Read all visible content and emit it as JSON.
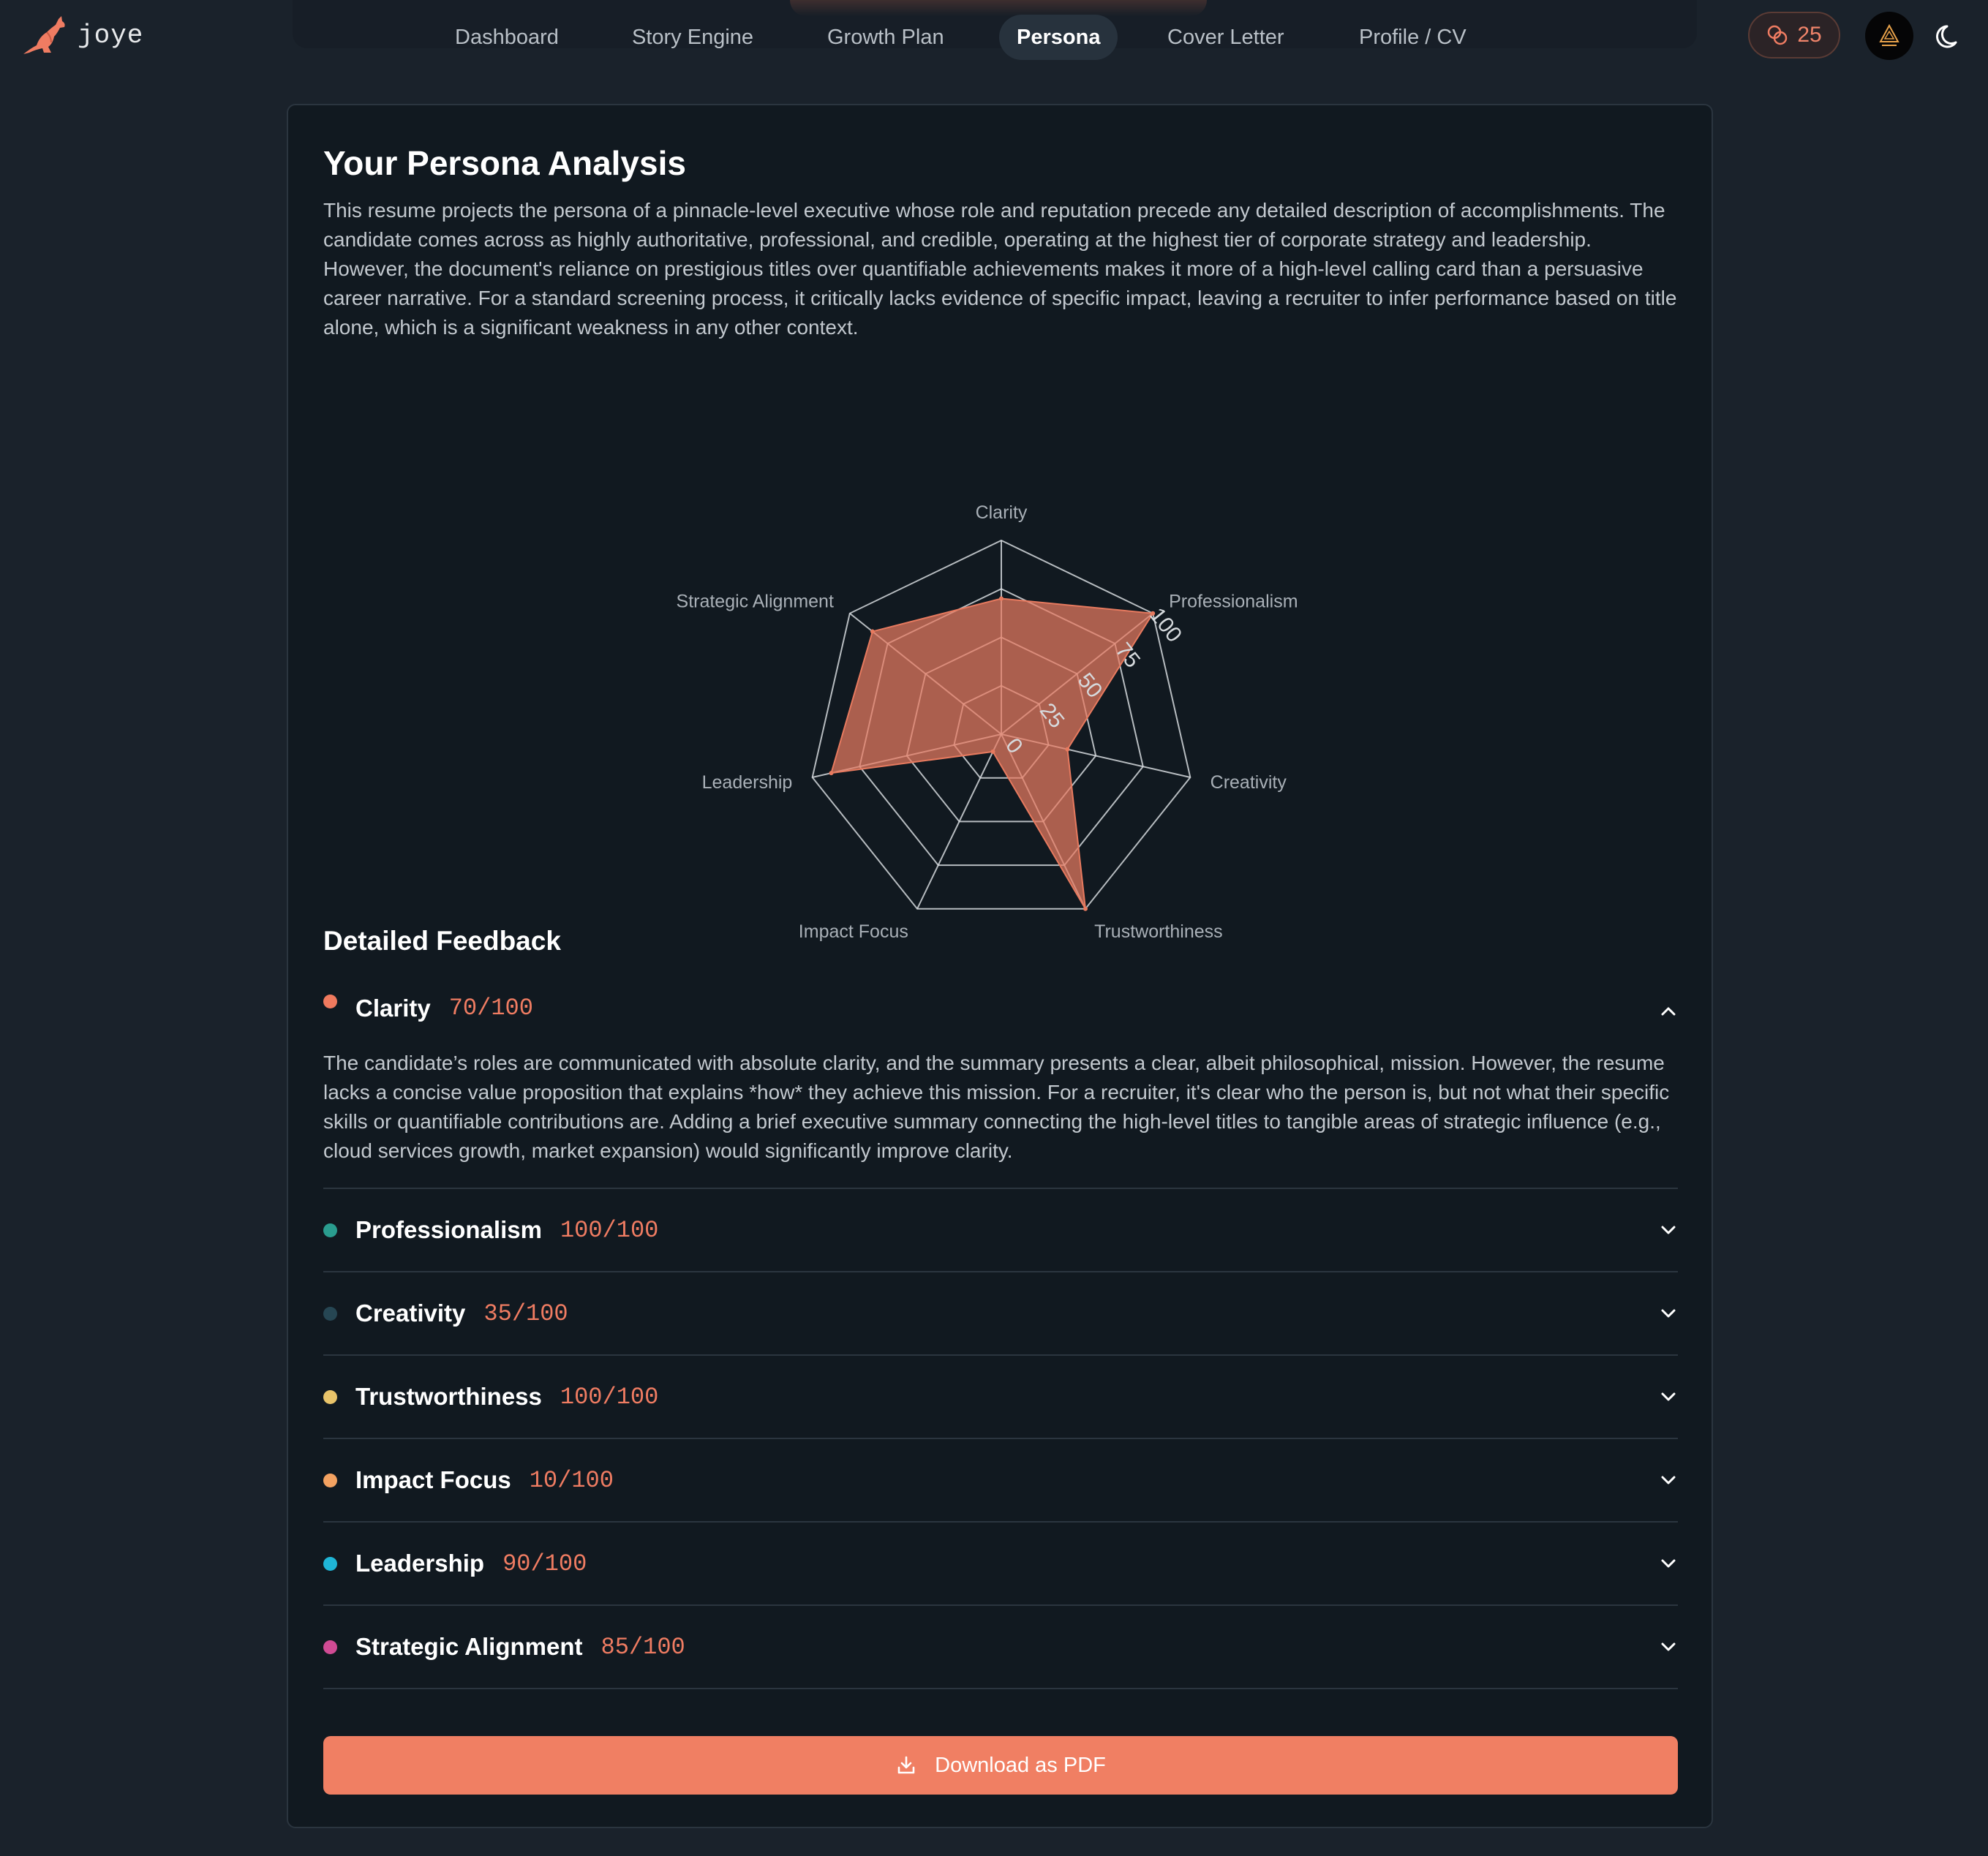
{
  "brand": {
    "name": "joye"
  },
  "nav": {
    "items": [
      {
        "label": "Dashboard"
      },
      {
        "label": "Story Engine"
      },
      {
        "label": "Growth Plan"
      },
      {
        "label": "Persona",
        "active": true
      },
      {
        "label": "Cover Letter"
      },
      {
        "label": "Profile / CV"
      }
    ]
  },
  "credits": {
    "count": "25",
    "icon": "coins-icon"
  },
  "page": {
    "title": "Your Persona Analysis",
    "summary": "This resume projects the persona of a pinnacle-level executive whose role and reputation precede any detailed description of accomplishments. The candidate comes across as highly authoritative, professional, and credible, operating at the highest tier of corporate strategy and leadership. However, the document's reliance on prestigious titles over quantifiable achievements makes it more of a high-level calling card than a persuasive career narrative. For a standard screening process, it critically lacks evidence of specific impact, leaving a recruiter to infer performance based on title alone, which is a significant weakness in any other context."
  },
  "chart_data": {
    "type": "radar",
    "axes": [
      "Clarity",
      "Professionalism",
      "Creativity",
      "Trustworthiness",
      "Impact Focus",
      "Leadership",
      "Strategic Alignment"
    ],
    "values": [
      70,
      100,
      35,
      100,
      10,
      90,
      85
    ],
    "range": [
      0,
      100
    ],
    "ticks": [
      "0",
      "25",
      "50",
      "75",
      "100"
    ],
    "fill_color": "#e77a5f",
    "grid_color": "#d5d9dd"
  },
  "feedback": {
    "title": "Detailed Feedback",
    "items": [
      {
        "name": "Clarity",
        "score": "70/100",
        "color": "#f07a5e",
        "open": true,
        "text": "The candidate’s roles are communicated with absolute clarity, and the summary presents a clear, albeit philosophical, mission. However, the resume lacks a concise value proposition that explains *how* they achieve this mission. For a recruiter, it's clear who the person is, but not what their specific skills or quantifiable contributions are. Adding a brief executive summary connecting the high-level titles to tangible areas of strategic influence (e.g., cloud services growth, market expansion) would significantly improve clarity."
      },
      {
        "name": "Professionalism",
        "score": "100/100",
        "color": "#2a9d8f",
        "open": false,
        "text": ""
      },
      {
        "name": "Creativity",
        "score": "35/100",
        "color": "#264653",
        "open": false,
        "text": ""
      },
      {
        "name": "Trustworthiness",
        "score": "100/100",
        "color": "#e9c46a",
        "open": false,
        "text": ""
      },
      {
        "name": "Impact Focus",
        "score": "10/100",
        "color": "#f4a261",
        "open": false,
        "text": ""
      },
      {
        "name": "Leadership",
        "score": "90/100",
        "color": "#1fb5d6",
        "open": false,
        "text": ""
      },
      {
        "name": "Strategic Alignment",
        "score": "85/100",
        "color": "#d14b94",
        "open": false,
        "text": ""
      }
    ]
  },
  "actions": {
    "download_label": "Download as PDF",
    "download_icon": "download-icon"
  }
}
